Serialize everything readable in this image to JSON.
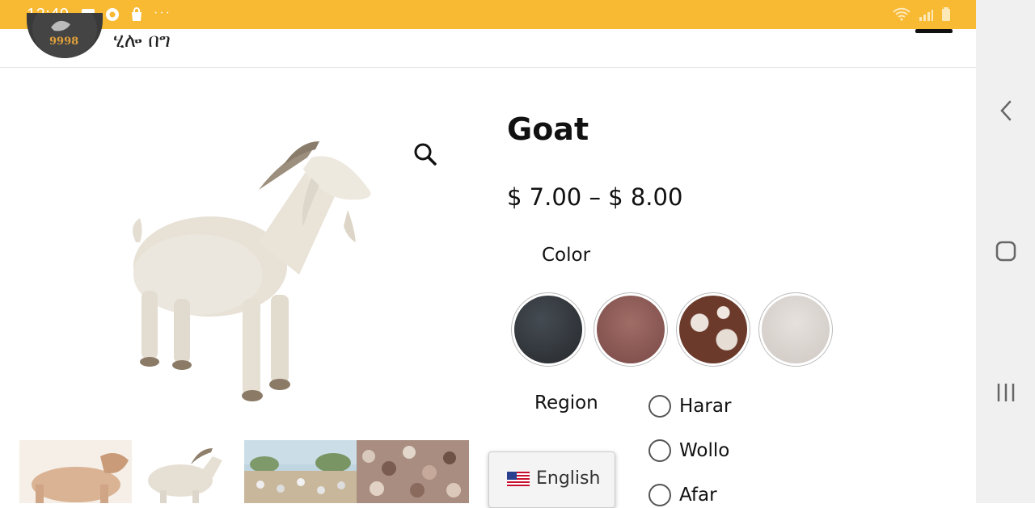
{
  "status_bar": {
    "time": "12:49",
    "more": "···",
    "color": "#f8b933"
  },
  "header": {
    "logo_number": "9998",
    "logo_text": "ሂሎ በግ"
  },
  "product": {
    "title": "Goat",
    "price": "$ 7.00 – $ 8.00",
    "color_label": "Color",
    "colors": [
      {
        "name": "black",
        "hex": "#2e3338"
      },
      {
        "name": "brown",
        "hex": "#8a5a55"
      },
      {
        "name": "spotted",
        "hex": "#6b3f2f"
      },
      {
        "name": "white",
        "hex": "#dcd6d2"
      }
    ],
    "region_label": "Region",
    "regions": [
      "Harar",
      "Wollo",
      "Afar"
    ]
  },
  "language": {
    "label": "English"
  },
  "icons": [
    "gallery-icon",
    "chrome-icon",
    "bag-icon",
    "wifi-icon",
    "signal-icon",
    "battery-icon",
    "zoom-icon",
    "back-icon",
    "home-icon",
    "recents-icon",
    "flag-us-icon"
  ]
}
